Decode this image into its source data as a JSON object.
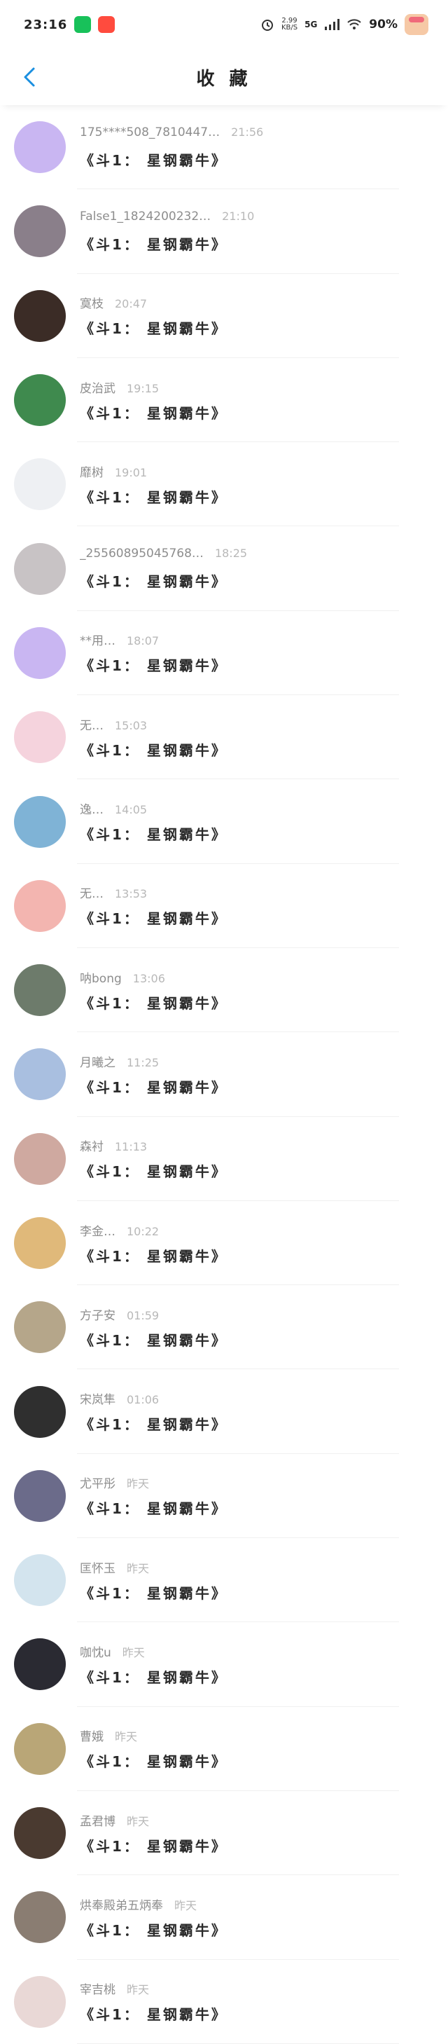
{
  "status_bar": {
    "time": "23:16",
    "net_speed_top": "2.99",
    "net_speed_bottom": "KB/S",
    "network": "5G",
    "battery": "90%"
  },
  "header": {
    "title": "收 藏"
  },
  "collection_items": [
    {
      "name": "175****508_7810447…",
      "time": "21:56",
      "content": "《斗1： 星钢霸牛》",
      "avatar_bg": "#c9b6f2"
    },
    {
      "name": "False1_1824200232…",
      "time": "21:10",
      "content": "《斗1： 星钢霸牛》",
      "avatar_bg": "#8a7f8a"
    },
    {
      "name": "寞枝",
      "time": "20:47",
      "content": "《斗1： 星钢霸牛》",
      "avatar_bg": "#3b2c26"
    },
    {
      "name": "皮治武",
      "time": "19:15",
      "content": "《斗1： 星钢霸牛》",
      "avatar_bg": "#3f8a4e"
    },
    {
      "name": "靡树",
      "time": "19:01",
      "content": "《斗1： 星钢霸牛》",
      "avatar_bg": "#eef0f3"
    },
    {
      "name": "_25560895045768…",
      "time": "18:25",
      "content": "《斗1： 星钢霸牛》",
      "avatar_bg": "#c8c3c5"
    },
    {
      "name": "**用…",
      "time": "18:07",
      "content": "《斗1： 星钢霸牛》",
      "avatar_bg": "#c9b6f2"
    },
    {
      "name": "无…",
      "time": "15:03",
      "content": "《斗1： 星钢霸牛》",
      "avatar_bg": "#f5d3dd"
    },
    {
      "name": "逸…",
      "time": "14:05",
      "content": "《斗1： 星钢霸牛》",
      "avatar_bg": "#7fb3d6"
    },
    {
      "name": "无…",
      "time": "13:53",
      "content": "《斗1： 星钢霸牛》",
      "avatar_bg": "#f3b5b0"
    },
    {
      "name": "呐bong",
      "time": "13:06",
      "content": "《斗1： 星钢霸牛》",
      "avatar_bg": "#6d7b6b"
    },
    {
      "name": "月曦之",
      "time": "11:25",
      "content": "《斗1： 星钢霸牛》",
      "avatar_bg": "#a9bfe0"
    },
    {
      "name": "森衬",
      "time": "11:13",
      "content": "《斗1： 星钢霸牛》",
      "avatar_bg": "#cfa9a0"
    },
    {
      "name": "李金…",
      "time": "10:22",
      "content": "《斗1： 星钢霸牛》",
      "avatar_bg": "#e0b97a"
    },
    {
      "name": "方子安",
      "time": "01:59",
      "content": "《斗1： 星钢霸牛》",
      "avatar_bg": "#b5a68a"
    },
    {
      "name": "宋岚隼",
      "time": "01:06",
      "content": "《斗1： 星钢霸牛》",
      "avatar_bg": "#2f2f2f"
    },
    {
      "name": "尤平彤",
      "time": "昨天",
      "content": "《斗1： 星钢霸牛》",
      "avatar_bg": "#6b6b8a"
    },
    {
      "name": "匡怀玉",
      "time": "昨天",
      "content": "《斗1： 星钢霸牛》",
      "avatar_bg": "#d3e4ee"
    },
    {
      "name": "咖忱u",
      "time": "昨天",
      "content": "《斗1： 星钢霸牛》",
      "avatar_bg": "#2a2a32"
    },
    {
      "name": "曹娥",
      "time": "昨天",
      "content": "《斗1： 星钢霸牛》",
      "avatar_bg": "#b9a677"
    },
    {
      "name": "孟君博",
      "time": "昨天",
      "content": "《斗1： 星钢霸牛》",
      "avatar_bg": "#4a3a30"
    },
    {
      "name": "烘奉殿弟五炳奉",
      "time": "昨天",
      "content": "《斗1： 星钢霸牛》",
      "avatar_bg": "#8a7d72"
    },
    {
      "name": "宰吉桃",
      "time": "昨天",
      "content": "《斗1： 星钢霸牛》",
      "avatar_bg": "#e9d8d6"
    }
  ]
}
